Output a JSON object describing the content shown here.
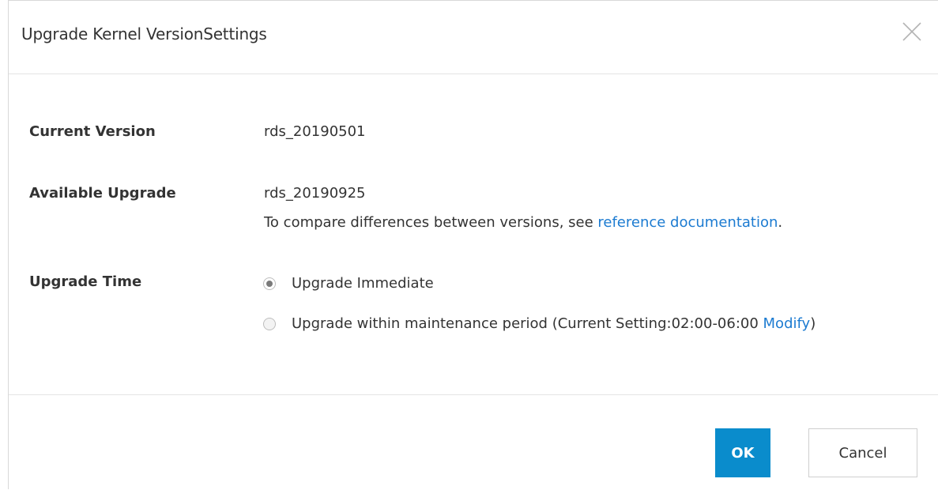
{
  "dialog": {
    "title": "Upgrade Kernel VersionSettings",
    "close_icon": "close-icon"
  },
  "current_version": {
    "label": "Current Version",
    "value": "rds_20190501"
  },
  "available_upgrade": {
    "label": "Available Upgrade",
    "value": "rds_20190925",
    "note_prefix": "To compare differences between versions, see ",
    "note_link": "reference documentation",
    "note_suffix": "."
  },
  "upgrade_time": {
    "label": "Upgrade Time",
    "options": [
      {
        "label": "Upgrade Immediate",
        "selected": true
      },
      {
        "label_prefix": "Upgrade within maintenance period (Current Setting:02:00-06:00 ",
        "link": "Modify",
        "label_suffix": ")",
        "selected": false
      }
    ]
  },
  "footer": {
    "ok_label": "OK",
    "cancel_label": "Cancel"
  },
  "colors": {
    "primary": "#0a8ccc",
    "link": "#1c7bd1",
    "text": "#333333",
    "border": "#e4e4e4"
  }
}
